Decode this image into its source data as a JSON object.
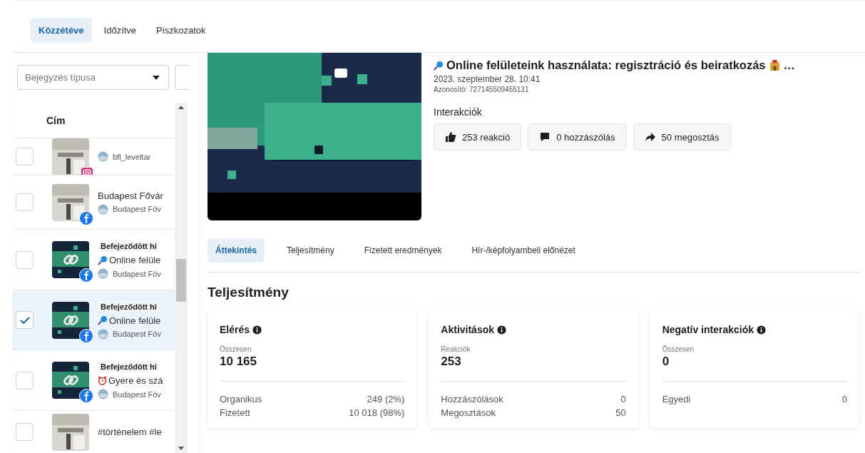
{
  "tabs": [
    {
      "label": "Közzétéve",
      "selected": true
    },
    {
      "label": "Időzítve",
      "selected": false
    },
    {
      "label": "Piszkozatok",
      "selected": false
    }
  ],
  "filter": {
    "placeholder": "Bejegyzés típusa"
  },
  "list": {
    "header": "Cím",
    "rows": [
      {
        "badge": {
          "kind": "instagram"
        },
        "link": false,
        "title": null,
        "account": "bfl_leveltar",
        "selected": false
      },
      {
        "badge": {
          "kind": "facebook"
        },
        "link": false,
        "title": "Budapest Fővár",
        "account": "Budapest Fóv",
        "selected": false
      },
      {
        "badge": {
          "kind": "facebook"
        },
        "link": true,
        "tag": "Befejeződött hi",
        "icon": {
          "kind": "magnifier"
        },
        "title": "Online felüle",
        "account": "Budapest Fóv",
        "selected": false
      },
      {
        "badge": {
          "kind": "facebook"
        },
        "link": true,
        "tag": "Befejeződött hi",
        "icon": {
          "kind": "magnifier"
        },
        "title": "Online felüle",
        "account": "Budapest Fóv",
        "selected": true
      },
      {
        "badge": {
          "kind": "facebook"
        },
        "link": true,
        "tag": "Befejeződött hi",
        "icon": {
          "kind": "alarm"
        },
        "title": "Gyere és szá",
        "account": "Budapest Fóv",
        "selected": false
      },
      {
        "link": false,
        "title": "#történelem #le",
        "selected": false
      }
    ]
  },
  "post": {
    "title": "Online felületeink használata: regisztráció és beiratkozás",
    "ellipsis": "…",
    "date": "2023. szeptember 28. 10:41",
    "id": "Azonosító: 727145509455131",
    "interactions_label": "Interakciók",
    "interactions": [
      {
        "kind": "like",
        "label": "253 reakció"
      },
      {
        "kind": "comment",
        "label": "0 hozzászólás"
      },
      {
        "kind": "share",
        "label": "50 megosztás"
      }
    ]
  },
  "detail_tabs": [
    {
      "label": "Áttekintés",
      "selected": true
    },
    {
      "label": "Teljesítmény",
      "selected": false
    },
    {
      "label": "Fizetett eredmények",
      "selected": false
    },
    {
      "label": "Hír-/képfolyambeli előnézet",
      "selected": false
    }
  ],
  "section_title": "Teljesítmény",
  "cards": [
    {
      "title": "Elérés",
      "sublabel": "Összesen",
      "value": "10 165",
      "rows": [
        {
          "label": "Organikus",
          "value": "249 (2%)"
        },
        {
          "label": "Fizetett",
          "value": "10 018 (98%)"
        }
      ]
    },
    {
      "title": "Aktivitások",
      "sublabel": "Reakciók",
      "value": "253",
      "rows": [
        {
          "label": "Hozzászólások",
          "value": "0"
        },
        {
          "label": "Megosztások",
          "value": "50"
        }
      ]
    },
    {
      "title": "Negatív interakciók",
      "sublabel": "Összesen",
      "value": "0",
      "rows": [
        {
          "label": "Egyedi",
          "value": "0"
        }
      ]
    }
  ]
}
